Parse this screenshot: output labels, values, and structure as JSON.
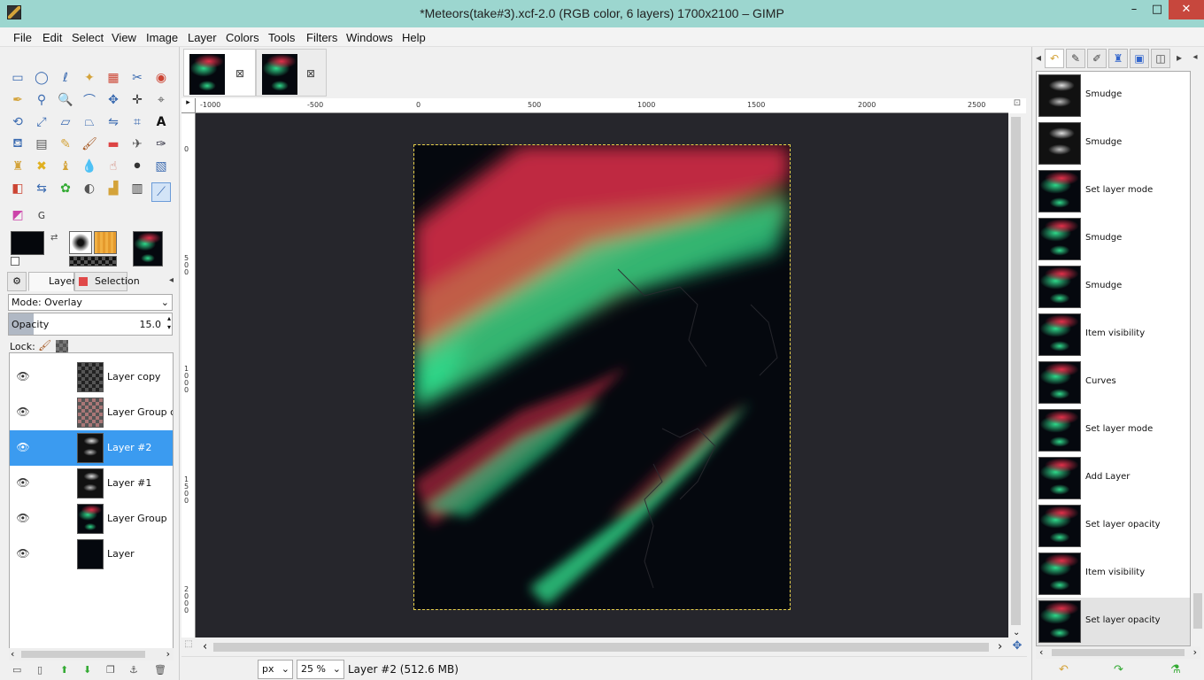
{
  "window": {
    "title": "*Meteors(take#3).xcf-2.0 (RGB color, 6 layers) 1700x2100 – GIMP",
    "minimize": "–",
    "maximize": "□",
    "close": "✕"
  },
  "menu": [
    "File",
    "Edit",
    "Select",
    "View",
    "Image",
    "Layer",
    "Colors",
    "Tools",
    "Filters",
    "Windows",
    "Help"
  ],
  "layers_panel": {
    "tabs": [
      "Layers",
      "Selection"
    ],
    "mode_label": "Mode: Overlay",
    "opacity_label": "Opacity",
    "opacity_value": "15.0",
    "opacity_fraction": 0.15,
    "lock_label": "Lock:",
    "layers": [
      {
        "name": "Layer copy",
        "selected": false
      },
      {
        "name": "Layer Group copy",
        "selected": false
      },
      {
        "name": "Layer #2",
        "selected": true
      },
      {
        "name": "Layer #1",
        "selected": false
      },
      {
        "name": "Layer Group",
        "selected": false
      },
      {
        "name": "Layer",
        "selected": false
      }
    ]
  },
  "ruler": {
    "h_labels": [
      "-1000",
      "-500",
      "0",
      "500",
      "1000",
      "1500",
      "2000",
      "2500"
    ],
    "v_labels": [
      "0",
      "500",
      "1000",
      "1500",
      "2000"
    ]
  },
  "status": {
    "unit": "px",
    "zoom": "25 %",
    "info": "Layer #2 (512.6 MB)"
  },
  "undo_history": [
    "Smudge",
    "Smudge",
    "Set layer mode",
    "Smudge",
    "Smudge",
    "Item visibility",
    "Curves",
    "Set layer mode",
    "Add Layer",
    "Set layer opacity",
    "Item visibility",
    "Set layer opacity"
  ],
  "colors": {
    "foreground": "#05070c",
    "background": "#ffffff",
    "selection_highlight": "#3b9bf0",
    "canvas_bg": "#26262c",
    "image_bg": "#05080e",
    "meteor_red": "#e0304a",
    "meteor_green": "#2fd88a"
  }
}
